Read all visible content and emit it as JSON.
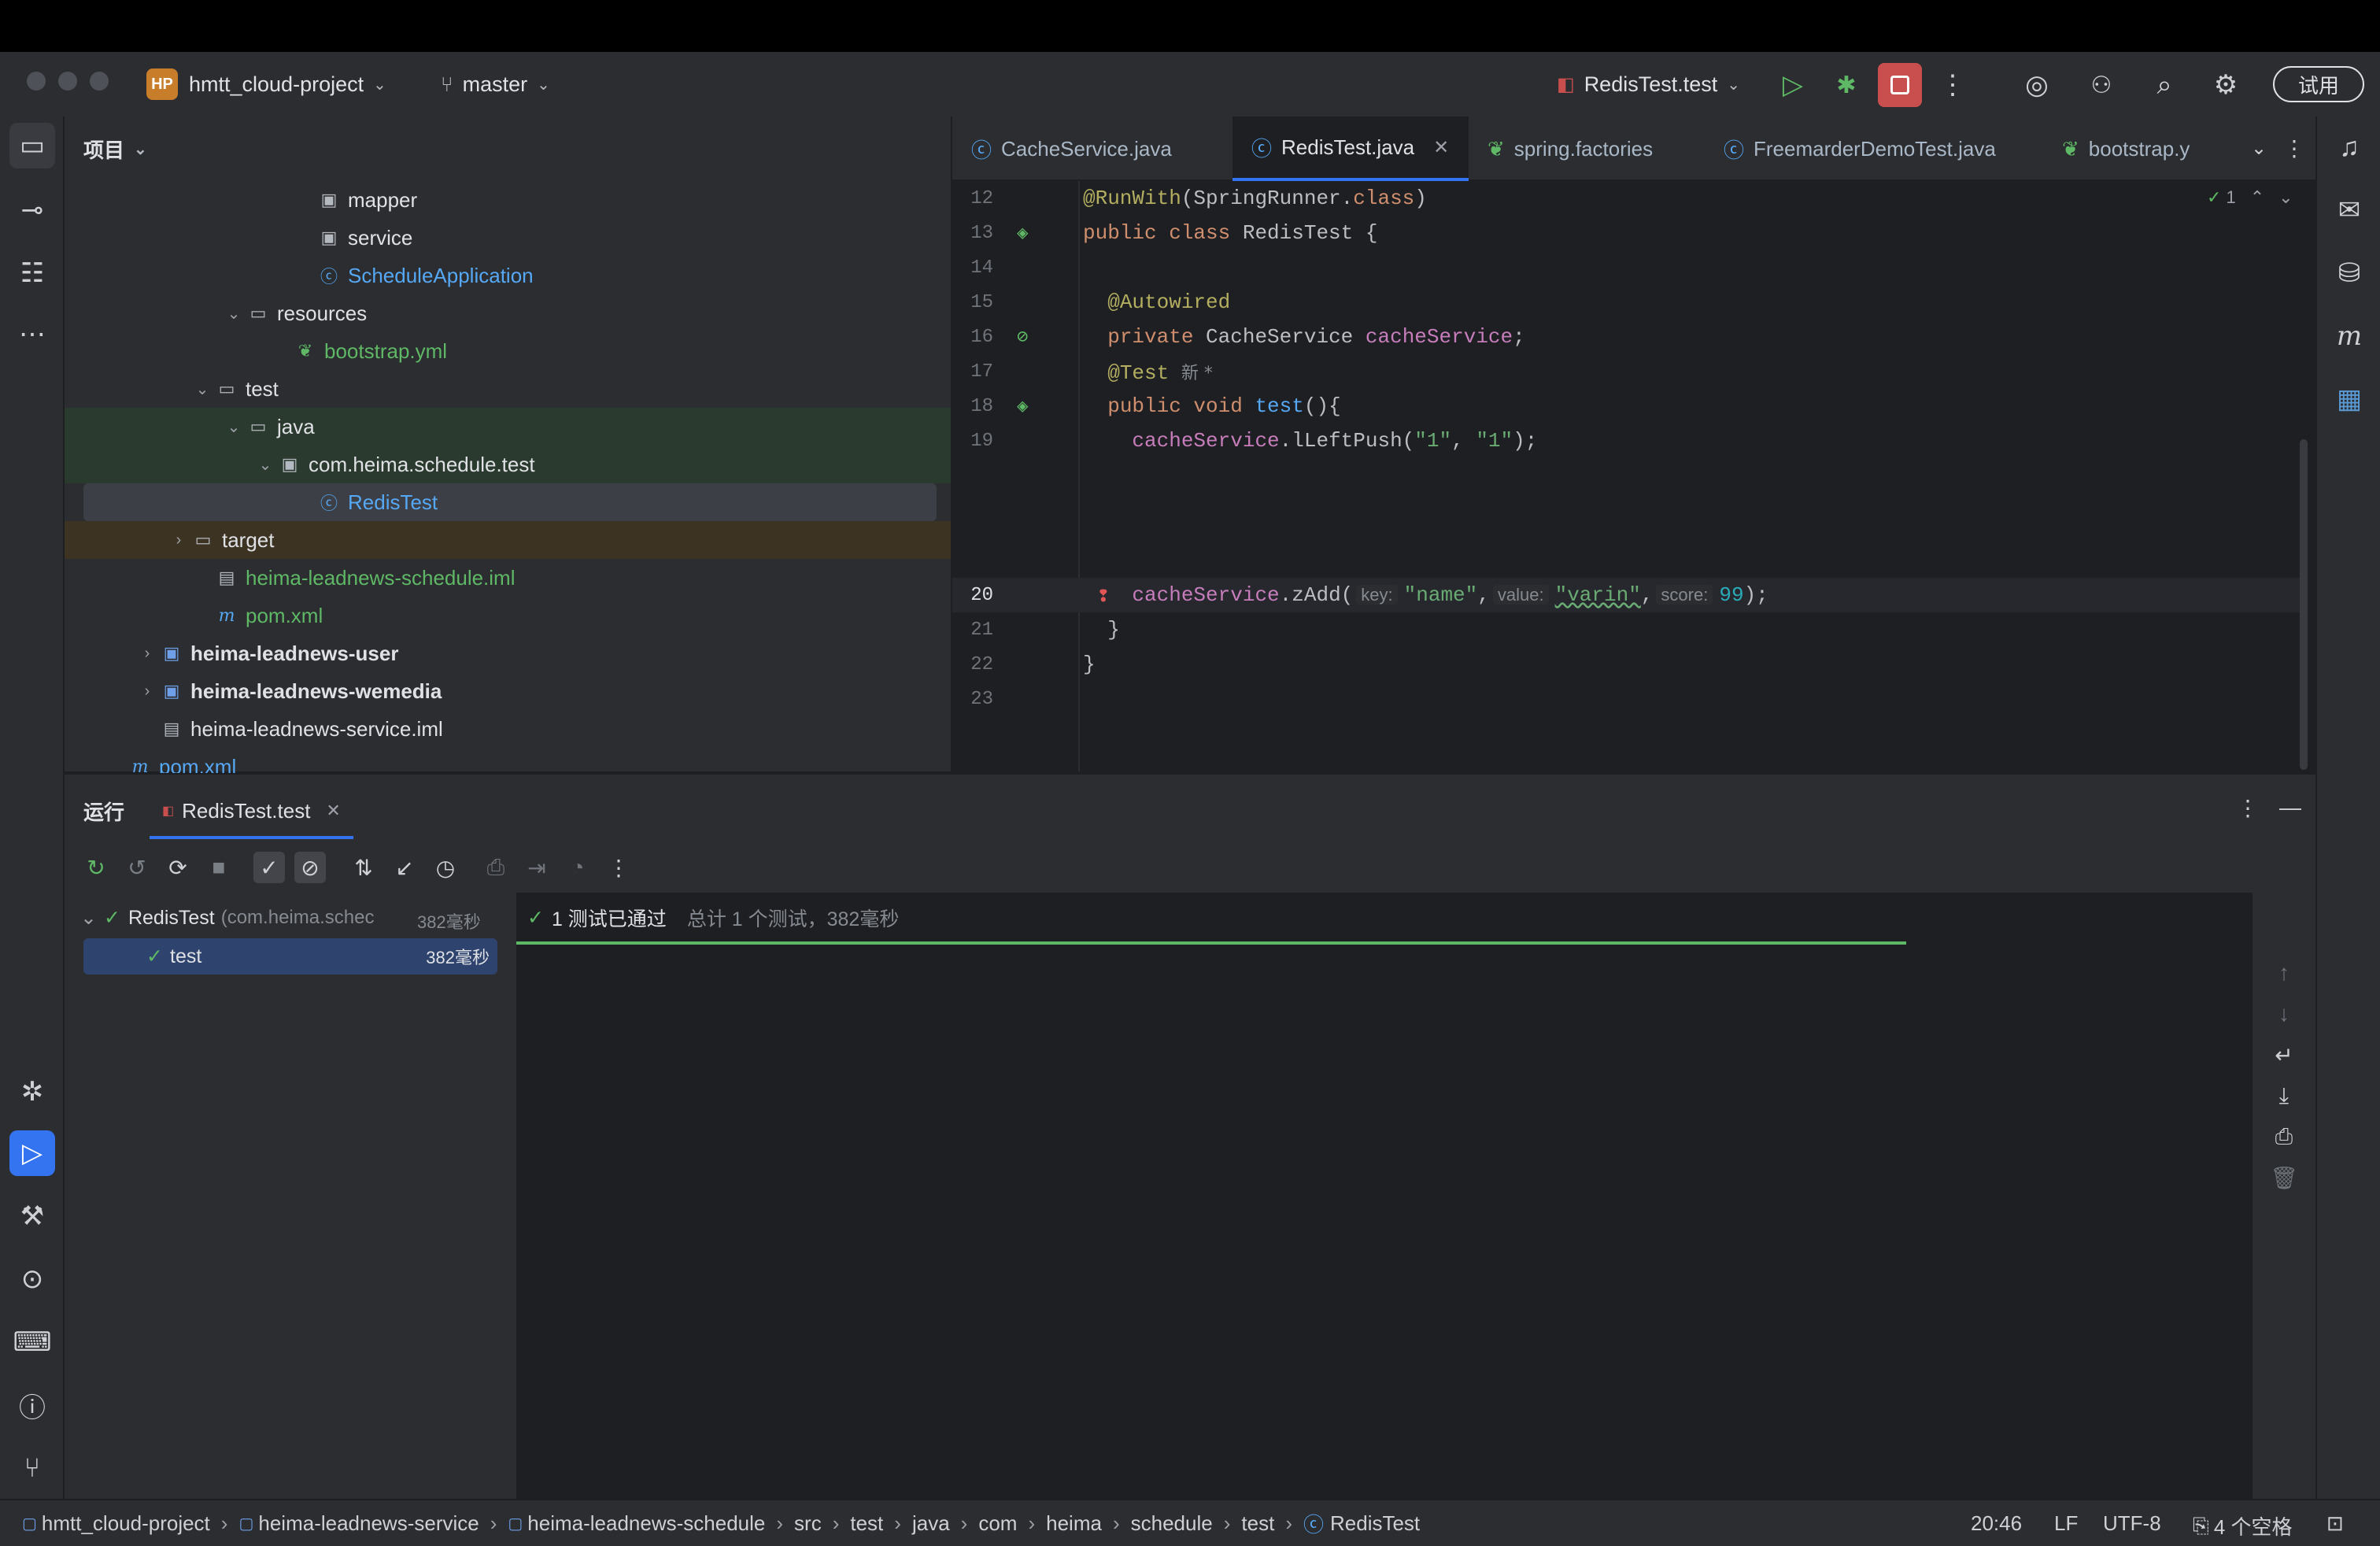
{
  "titlebar": {
    "project_badge": "HP",
    "project_name": "hmtt_cloud-project",
    "branch": "master",
    "run_config": "RedisTest.test",
    "trial_button": "试用"
  },
  "project_panel": {
    "title": "项目",
    "tree": [
      {
        "label": "mapper",
        "kind": "package",
        "color": "normal"
      },
      {
        "label": "service",
        "kind": "package",
        "color": "normal"
      },
      {
        "label": "ScheduleApplication",
        "kind": "class",
        "color": "#56a8f5"
      },
      {
        "label": "resources",
        "kind": "folder",
        "color": "normal"
      },
      {
        "label": "bootstrap.yml",
        "kind": "yml",
        "color": "#5fb865"
      },
      {
        "label": "test",
        "kind": "folder",
        "color": "normal"
      },
      {
        "label": "java",
        "kind": "folder",
        "color": "normal"
      },
      {
        "label": "com.heima.schedule.test",
        "kind": "package",
        "color": "normal"
      },
      {
        "label": "RedisTest",
        "kind": "class",
        "color": "#56a8f5"
      },
      {
        "label": "target",
        "kind": "folder",
        "color": "normal"
      },
      {
        "label": "heima-leadnews-schedule.iml",
        "kind": "iml",
        "color": "#5fb865"
      },
      {
        "label": "pom.xml",
        "kind": "maven",
        "color": "#5fb865"
      },
      {
        "label": "heima-leadnews-user",
        "kind": "module",
        "color": "bold"
      },
      {
        "label": "heima-leadnews-wemedia",
        "kind": "module",
        "color": "bold"
      },
      {
        "label": "heima-leadnews-service.iml",
        "kind": "iml",
        "color": "normal"
      },
      {
        "label": "pom.xml",
        "kind": "maven",
        "color": "#56a8f5"
      }
    ]
  },
  "editor": {
    "tabs": [
      {
        "label": "CacheService.java"
      },
      {
        "label": "RedisTest.java"
      },
      {
        "label": "spring.factories"
      },
      {
        "label": "FreemarderDemoTest.java"
      },
      {
        "label": "bootstrap.y"
      }
    ],
    "inspection_count": "1",
    "line_numbers": [
      "12",
      "13",
      "14",
      "15",
      "16",
      "17",
      "18",
      "19",
      "20",
      "21",
      "22",
      "23"
    ],
    "code": {
      "l12_ann": "@RunWith",
      "l12_rest": "(SpringRunner.",
      "l12_kw": "class",
      "l12_end": ")",
      "l13_kw": "public class ",
      "l13_rest": "RedisTest {",
      "l15_ann": "@Autowired",
      "l16_kw": "private ",
      "l16_type": "CacheService ",
      "l16_fld": "cacheService",
      "l16_end": ";",
      "l17_ann": "@Test",
      "l17_hint": "新 *",
      "l18_kw": "public void ",
      "l18_fn": "test",
      "l18_end": "(){",
      "l19_fld": "cacheService",
      "l19_call": ".lLeftPush(",
      "l19_s1": "\"1\"",
      "l19_comma": ", ",
      "l19_s2": "\"1\"",
      "l19_end": ");",
      "l20_fld": "cacheService",
      "l20_call": ".zAdd(",
      "l20_h1": "key:",
      "l20_s1": "\"name\"",
      "l20_c1": ",",
      "l20_h2": "value:",
      "l20_s2": "\"varin\"",
      "l20_c2": ",",
      "l20_h3": "score:",
      "l20_num": "99",
      "l20_end": ");",
      "l21": "}",
      "l22": "}"
    }
  },
  "run_panel": {
    "title": "运行",
    "tab": "RedisTest.test",
    "tree_root": "RedisTest",
    "tree_root_pkg": "(com.heima.schec",
    "tree_root_time": "382毫秒",
    "tree_child": "test",
    "tree_child_time": "382毫秒",
    "result": "1 测试已通过",
    "summary": "总计 1 个测试，382毫秒"
  },
  "statusbar": {
    "crumbs": [
      "hmtt_cloud-project",
      "heima-leadnews-service",
      "heima-leadnews-schedule",
      "src",
      "test",
      "java",
      "com",
      "heima",
      "schedule",
      "test",
      "RedisTest"
    ],
    "position": "20:46",
    "line_sep": "LF",
    "encoding": "UTF-8",
    "indent": "4 个空格"
  }
}
